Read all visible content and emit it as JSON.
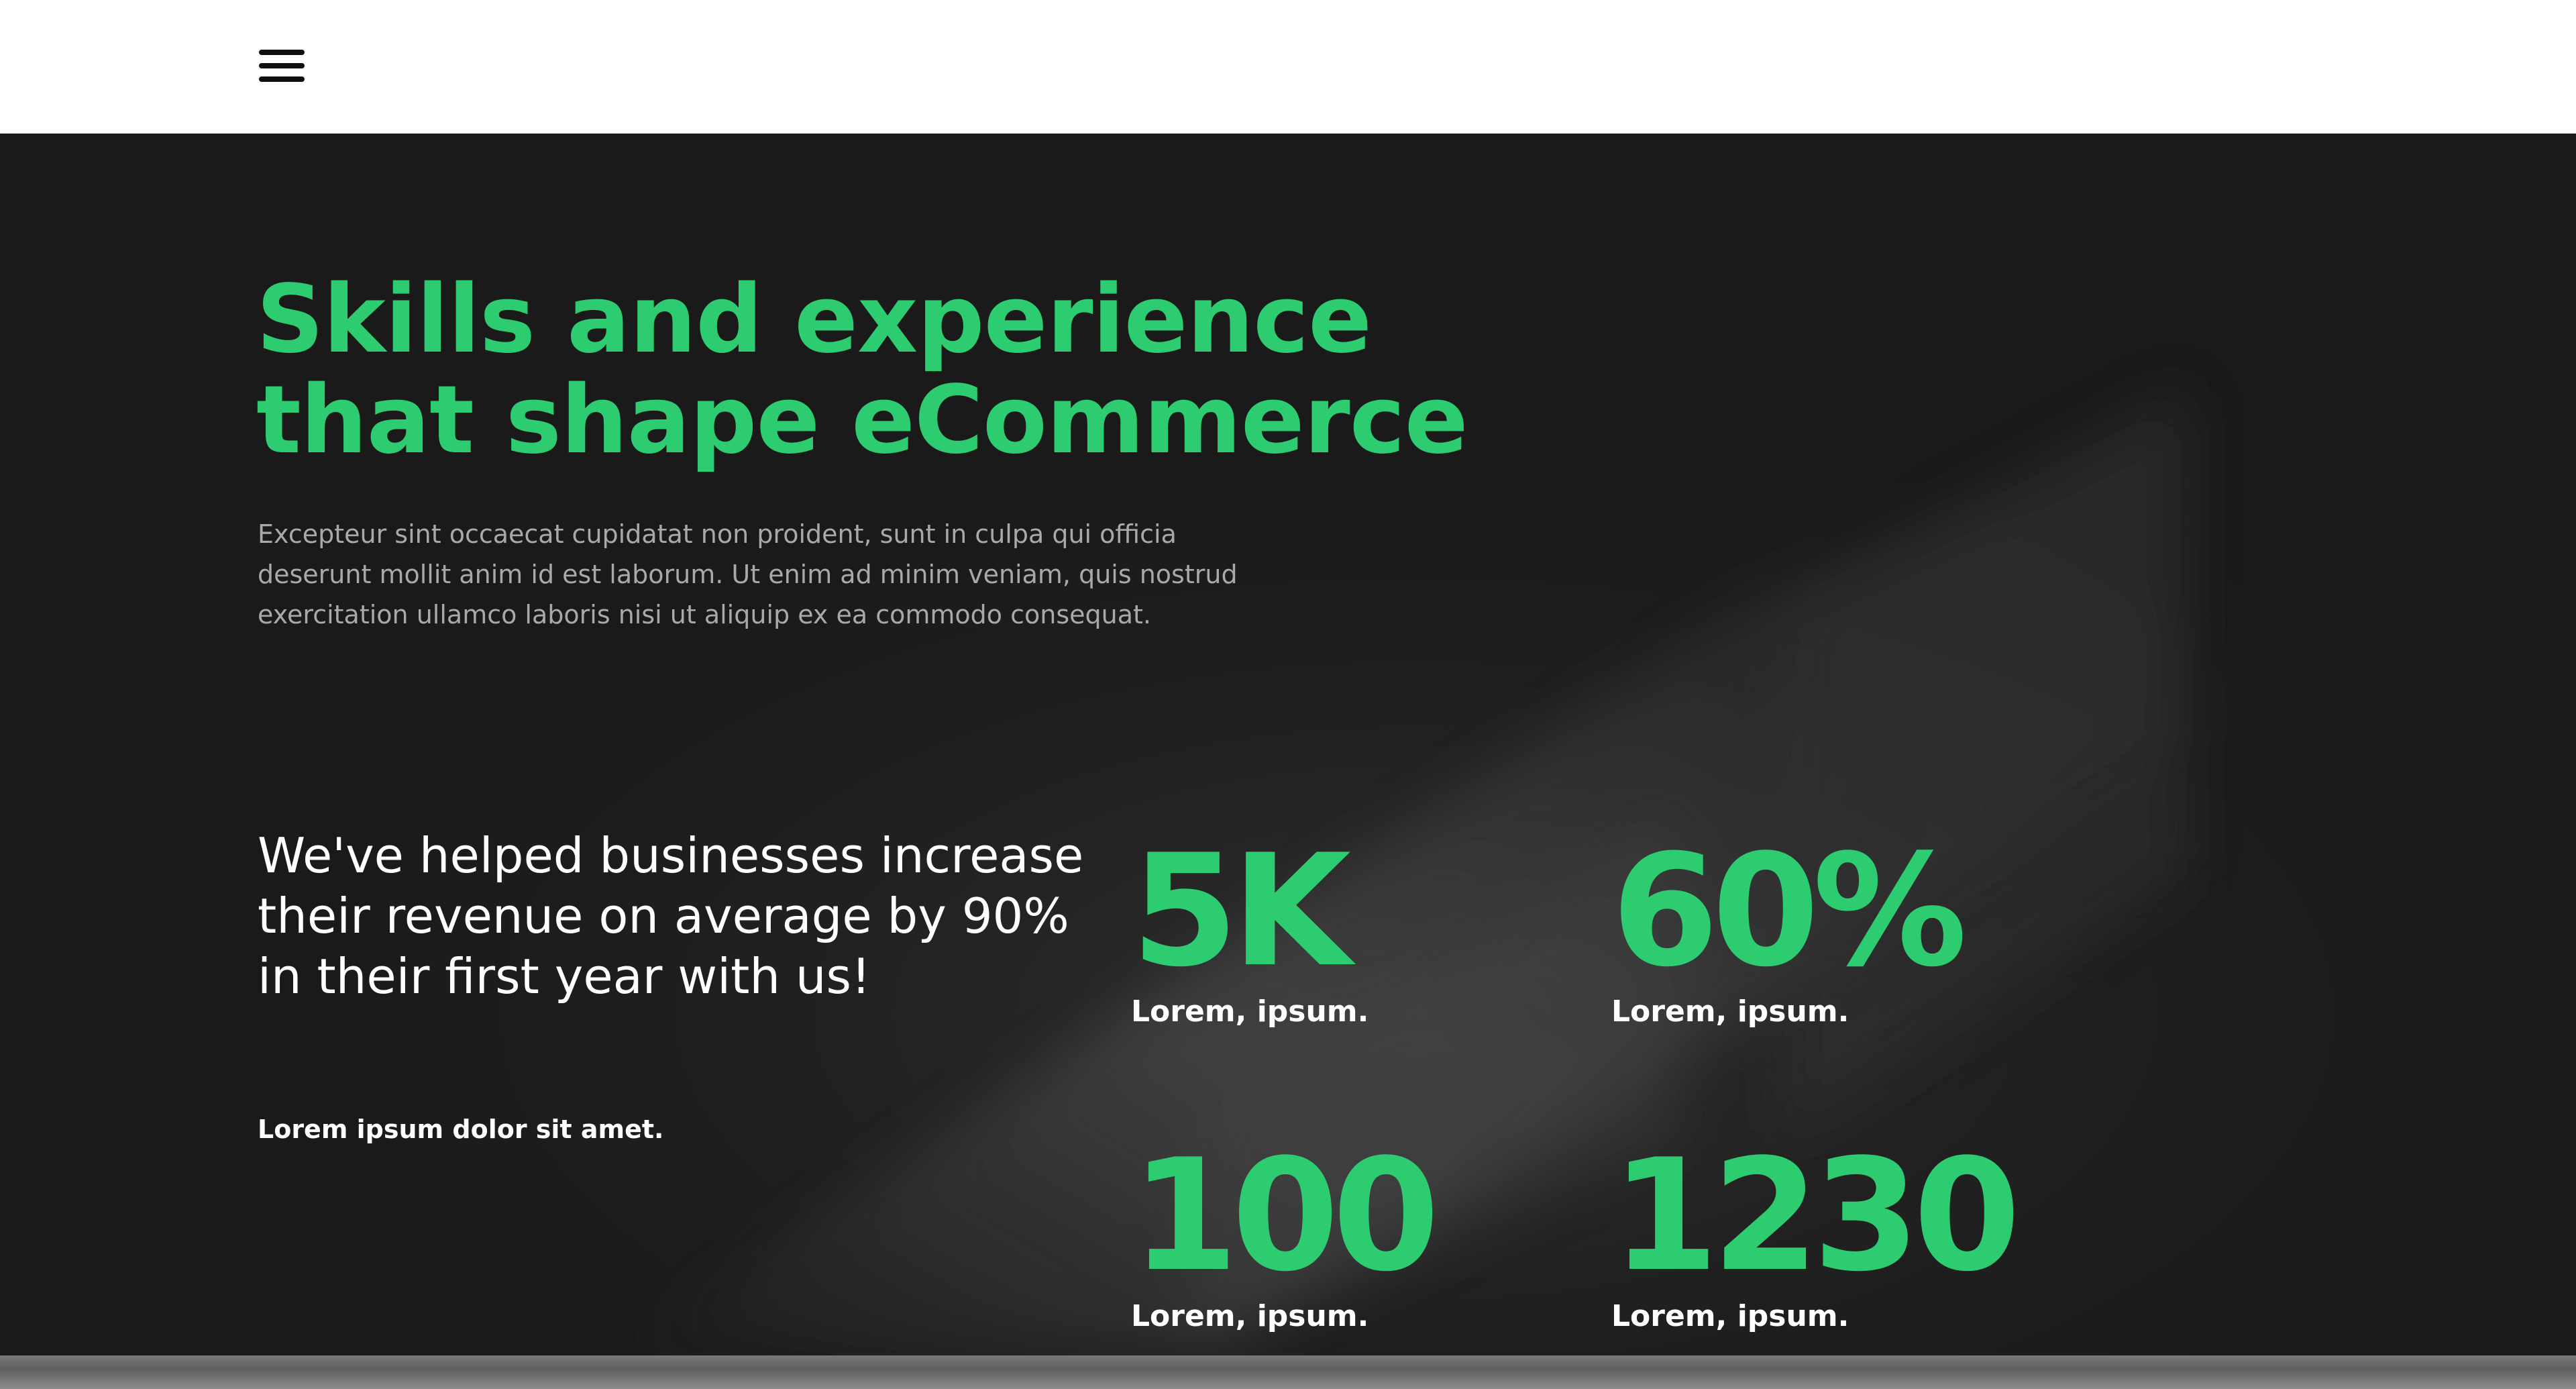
{
  "header": {
    "menu_icon": "hamburger-menu-icon"
  },
  "hero": {
    "title_line1": "Skills and experience",
    "title_line2": "that shape eCommerce",
    "description": "Excepteur sint occaecat cupidatat non proident, sunt in culpa qui officia deserunt mollit anim id est laborum. Ut enim ad minim veniam, quis nostrud exercitation ullamco laboris nisi ut aliquip ex ea commodo consequat.",
    "highlight": "We've helped businesses increase their revenue on average by 90% in their first year with us!",
    "highlight_sub": "Lorem ipsum dolor sit amet."
  },
  "stats": [
    {
      "value": "5K",
      "label": "Lorem, ipsum."
    },
    {
      "value": "60%",
      "label": "Lorem, ipsum."
    },
    {
      "value": "100",
      "label": "Lorem, ipsum."
    },
    {
      "value": "1230",
      "label": "Lorem, ipsum."
    }
  ],
  "colors": {
    "accent": "#2ecc71",
    "background": "#1b1b1b",
    "header_bg": "#ffffff",
    "text_primary": "#ffffff",
    "text_muted": "#a9a9a9"
  }
}
